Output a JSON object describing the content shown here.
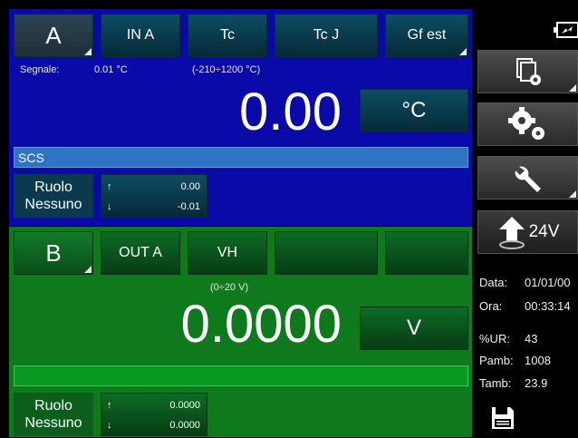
{
  "channelA": {
    "name": "A",
    "buttons": [
      "IN A",
      "Tc",
      "Tc J",
      "Gf est"
    ],
    "signal_label": "Segnale:",
    "signal_value": "0.01 °C",
    "range": "(-210÷1200 °C)",
    "value": "0.00",
    "unit": "°C",
    "scs_label": "SCS",
    "role_line1": "Ruolo",
    "role_line2": "Nessuno",
    "limit_up_arrow": "↑",
    "limit_up": "0.00",
    "limit_down_arrow": "↓",
    "limit_down": "-0.01"
  },
  "channelB": {
    "name": "B",
    "buttons": [
      "OUT A",
      "VH",
      "",
      ""
    ],
    "range": "(0÷20 V)",
    "value": "0.0000",
    "unit": "V",
    "role_line1": "Ruolo",
    "role_line2": "Nessuno",
    "limit_up_arrow": "↑",
    "limit_up": "0.0000",
    "limit_down_arrow": "↓",
    "limit_down": "0.0000"
  },
  "sidebar": {
    "power_button": "24V",
    "info": [
      {
        "label": "Data:",
        "value": "01/01/00"
      },
      {
        "label": "Ora:",
        "value": "00:33:14"
      },
      {
        "label": "%UR:",
        "value": "43"
      },
      {
        "label": "Pamb:",
        "value": "1008"
      },
      {
        "label": "Tamb:",
        "value": "23.9"
      }
    ]
  },
  "colors": {
    "panelA": "#0a0aa8",
    "panelB": "#0e7a1c",
    "scs_bar": "#2f73c5"
  }
}
